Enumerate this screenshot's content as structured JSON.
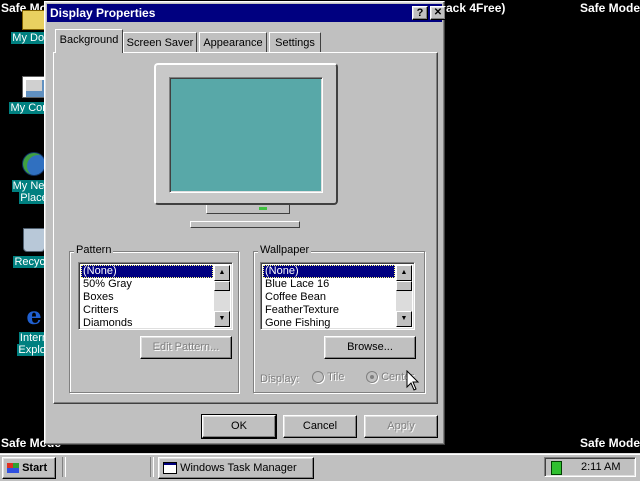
{
  "desktop": {
    "safe_mode": "Safe Mode",
    "bg_text_fragment": "ack 4Free)",
    "icons": [
      {
        "label": "My Docu",
        "icon": "my-documents-icon"
      },
      {
        "label": "My Comp",
        "icon": "my-computer-icon"
      },
      {
        "label1": "My Netw",
        "label2": "Place",
        "icon": "network-places-icon"
      },
      {
        "label": "Recycle",
        "icon": "recycle-bin-icon"
      },
      {
        "label1": "Intern",
        "label2": "Explor",
        "icon": "internet-explorer-icon"
      }
    ]
  },
  "dialog": {
    "title": "Display Properties",
    "help_button": "?",
    "close_button": "✕",
    "tabs": [
      "Background",
      "Screen Saver",
      "Appearance",
      "Settings"
    ],
    "active_tab": "Background",
    "pattern": {
      "label": "Pattern",
      "items": [
        "(None)",
        "50% Gray",
        "Boxes",
        "Critters",
        "Diamonds"
      ],
      "selected": "(None)",
      "edit_button": "Edit Pattern..."
    },
    "wallpaper": {
      "label": "Wallpaper",
      "items": [
        "(None)",
        "Blue Lace 16",
        "Coffee Bean",
        "FeatherTexture",
        "Gone Fishing"
      ],
      "selected": "(None)",
      "browse_button": "Browse...",
      "display_label": "Display:",
      "display_options": [
        "Tile",
        "Center"
      ]
    },
    "buttons": {
      "ok": "OK",
      "cancel": "Cancel",
      "apply": "Apply"
    },
    "colors": {
      "title_bar": "#000080",
      "monitor_screen": "#58a8a8",
      "desktop_icon_label_bg": "#008080"
    }
  },
  "taskbar": {
    "start_label": "Start",
    "task_item": "Windows Task Manager",
    "clock": "2:11 AM"
  }
}
